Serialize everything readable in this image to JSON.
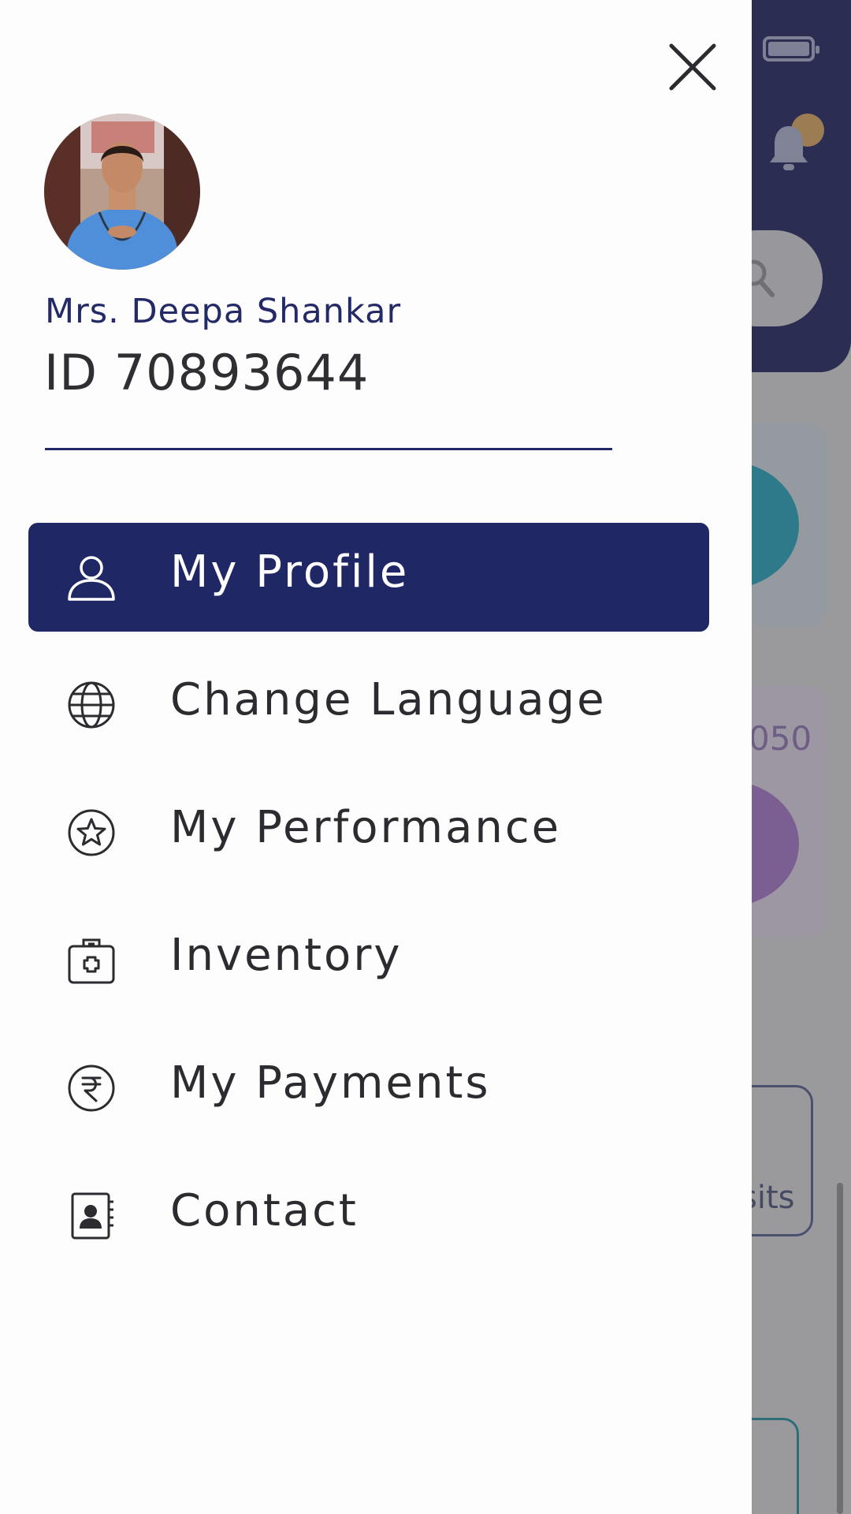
{
  "background": {
    "partial_number": "050",
    "partial_button_text": "sits"
  },
  "drawer": {
    "user": {
      "name": "Mrs. Deepa Shankar",
      "id_text": "ID 70893644"
    },
    "menu": [
      {
        "label": "My Profile",
        "icon": "user-icon",
        "active": true
      },
      {
        "label": "Change Language",
        "icon": "globe-icon",
        "active": false
      },
      {
        "label": "My Performance",
        "icon": "star-badge-icon",
        "active": false
      },
      {
        "label": "Inventory",
        "icon": "medical-kit-icon",
        "active": false
      },
      {
        "label": "My Payments",
        "icon": "rupee-icon",
        "active": false
      },
      {
        "label": "Contact",
        "icon": "contact-book-icon",
        "active": false
      }
    ]
  },
  "colors": {
    "primary": "#1f2764",
    "drawer_bg": "#fdfdfe",
    "text": "#2c2c30",
    "notification_dot": "#9c7c52"
  }
}
